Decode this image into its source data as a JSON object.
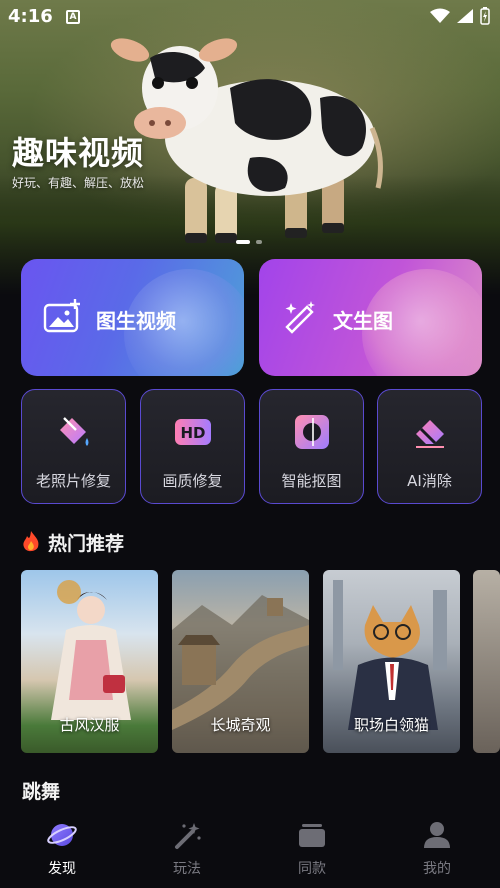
{
  "status_bar": {
    "time": "4:16",
    "badge": "A"
  },
  "hero": {
    "title": "趣味视频",
    "subtitle": "好玩、有趣、解压、放松",
    "slides": 2,
    "active_slide": 1
  },
  "features": [
    {
      "label": "图生视频",
      "icon": "image-plus-icon"
    },
    {
      "label": "文生图",
      "icon": "magic-pen-icon"
    }
  ],
  "tools": [
    {
      "label": "老照片修复",
      "icon": "paint-bucket-icon"
    },
    {
      "label": "画质修复",
      "icon": "hd-icon"
    },
    {
      "label": "智能抠图",
      "icon": "cutout-icon"
    },
    {
      "label": "AI消除",
      "icon": "eraser-icon"
    }
  ],
  "hot": {
    "title": "热门推荐",
    "items": [
      {
        "label": "古风汉服"
      },
      {
        "label": "长城奇观"
      },
      {
        "label": "职场白领猫"
      }
    ]
  },
  "dance": {
    "title": "跳舞"
  },
  "nav": [
    {
      "label": "发现",
      "icon": "planet-icon",
      "active": true
    },
    {
      "label": "玩法",
      "icon": "magic-wand-icon",
      "active": false
    },
    {
      "label": "同款",
      "icon": "stack-icon",
      "active": false
    },
    {
      "label": "我的",
      "icon": "person-icon",
      "active": false
    }
  ],
  "colors": {
    "accent": "#6a55f0",
    "feature_right": "#a244ea",
    "background": "#0b0b0f"
  }
}
